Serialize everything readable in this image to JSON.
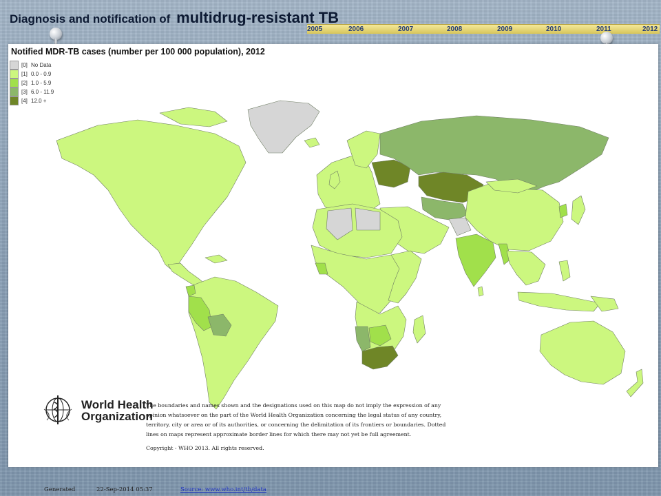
{
  "title": {
    "prefix": "Diagnosis and notification of",
    "main": "multidrug-resistant TB"
  },
  "timeline": {
    "years": [
      "2005",
      "2006",
      "2007",
      "2008",
      "2009",
      "2010",
      "2011",
      "2012"
    ],
    "selected": "2012"
  },
  "map": {
    "title": "Notified MDR-TB cases (number per 100 000 population), 2012",
    "legend": [
      {
        "code": "[0]",
        "label": "No Data",
        "color": "#d6d6d6"
      },
      {
        "code": "[1]",
        "label": "0.0 - 0.9",
        "color": "#ccf77f"
      },
      {
        "code": "[2]",
        "label": "1.0 - 5.9",
        "color": "#a1e04b"
      },
      {
        "code": "[3]",
        "label": "6.0 - 11.9",
        "color": "#8cb76a"
      },
      {
        "code": "[4]",
        "label": "12.0 +",
        "color": "#6f8627"
      }
    ],
    "ocean_color": "#ffffff"
  },
  "who": {
    "logo_line1": "World Health",
    "logo_line2": "Organization"
  },
  "disclaimer": {
    "lines": [
      "The boundaries and names shown and the designations used on this map do not imply the expression of any",
      "opinion whatsoever on the part of the World Health Organization concerning the legal status of any country,",
      "territory, city or area or of its authorities, or concerning the delimitation of its frontiers or boundaries. Dotted",
      "lines on maps represent approximate border lines for which there may not yet be full agreement."
    ],
    "copyright": "Copyright - WHO 2013. All rights reserved."
  },
  "footer": {
    "generated_label": "Generated",
    "generated_date": "22-Sep-2014 05:37",
    "source_label": "Source:  www.who.int/tb/data"
  }
}
